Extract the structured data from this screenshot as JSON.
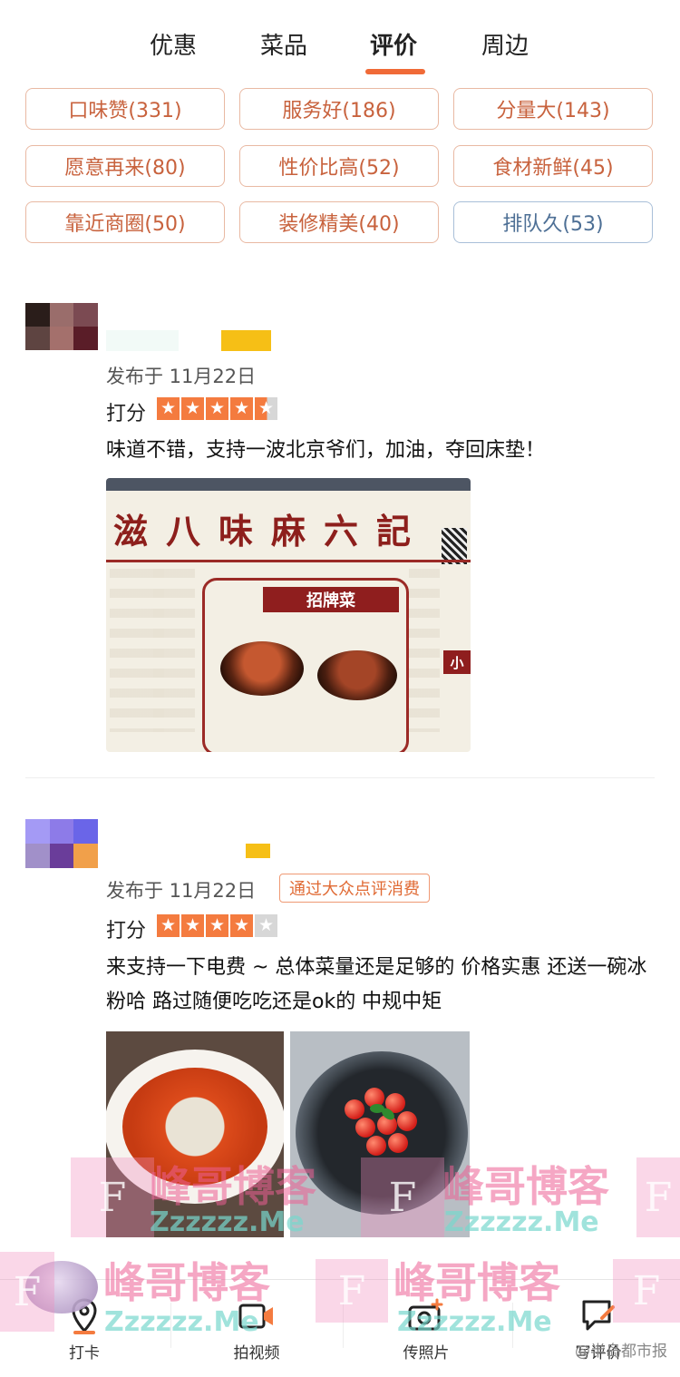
{
  "tabs": [
    {
      "label": "优惠",
      "active": false
    },
    {
      "label": "菜品",
      "active": false
    },
    {
      "label": "评价",
      "active": true
    },
    {
      "label": "周边",
      "active": false
    }
  ],
  "tags": [
    {
      "label": "口味赞(331)",
      "negative": false
    },
    {
      "label": "服务好(186)",
      "negative": false
    },
    {
      "label": "分量大(143)",
      "negative": false
    },
    {
      "label": "愿意再来(80)",
      "negative": false
    },
    {
      "label": "性价比高(52)",
      "negative": false
    },
    {
      "label": "食材新鲜(45)",
      "negative": false
    },
    {
      "label": "靠近商圈(50)",
      "negative": false
    },
    {
      "label": "装修精美(40)",
      "negative": false
    },
    {
      "label": "排队久(53)",
      "negative": true
    }
  ],
  "reviews": [
    {
      "published": "发布于 11月22日",
      "score_label": "打分",
      "rating": 4.5,
      "comment": "味道不错，支持一波北京爷们，加油，夺回床垫！",
      "photo": {
        "restaurant_name": "滋八味麻六記",
        "signature_label": "招牌菜",
        "small_label": "小"
      }
    },
    {
      "published": "发布于 11月22日",
      "badge": "通过大众点评消费",
      "score_label": "打分",
      "rating": 4,
      "comment": "来支持一下电费 ~ 总体菜量还是足够的 价格实惠 还送一碗冰粉哈 路过随便吃吃还是ok的 中规中矩"
    }
  ],
  "watermark": {
    "brand": "峰哥博客",
    "domain": "Zzzzzz.Me",
    "letter": "F"
  },
  "bottom_bar": {
    "checkin": "打卡",
    "video": "拍视频",
    "photo": "传照片",
    "write_review": "写评价"
  },
  "credit": "@半岛都市报",
  "colors": {
    "accent": "#f06a37",
    "star": "#f47b3f",
    "tag_text": "#c8623d",
    "negative_tag_text": "#4d6f95"
  }
}
